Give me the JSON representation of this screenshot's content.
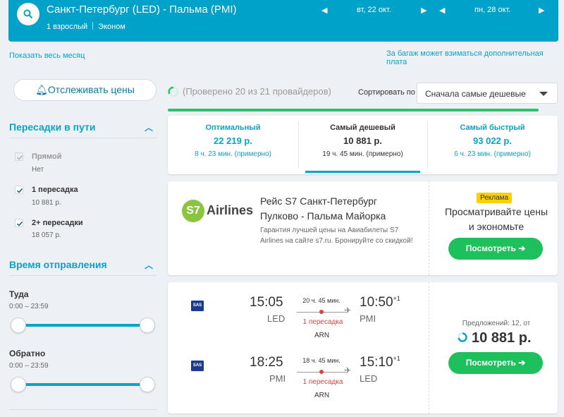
{
  "header": {
    "route": "Санкт-Петербург (LED) - Пальма (PMI)",
    "passengers": "1 взрослый",
    "cabin": "Эконом",
    "depart_date": "вт, 22 окт.",
    "return_date": "пн, 28 окт."
  },
  "links": {
    "show_month": "Показать весь месяц",
    "baggage_note": "За багаж может взиматься дополнительная плата"
  },
  "sidebar": {
    "track_label": "Отслеживать цены",
    "stops_title": "Пересадки в пути",
    "stops": [
      {
        "label": "Прямой",
        "sub": "Нет",
        "checked": true,
        "disabled": true
      },
      {
        "label": "1 пересадка",
        "sub": "10 881 р.",
        "checked": true,
        "disabled": false
      },
      {
        "label": "2+ пересадки",
        "sub": "18 057 р.",
        "checked": true,
        "disabled": false
      }
    ],
    "time_title": "Время отправления",
    "outbound_label": "Туда",
    "outbound_range": "0:00 – 23:59",
    "return_label": "Обратно",
    "return_range": "0:00 – 23:59"
  },
  "results": {
    "checked_text": "(Проверено 20 из 21 провайдеров)",
    "progress": 0.95,
    "sort_label": "Сортировать по",
    "sort_value": "Сначала самые дешевые",
    "tabs": [
      {
        "title": "Оптимальный",
        "price": "22 219 р.",
        "duration": "8 ч. 23 мин. (примерно)"
      },
      {
        "title": "Самый дешевый",
        "price": "10 881 р.",
        "duration": "19 ч. 45 мин. (примерно)"
      },
      {
        "title": "Самый быстрый",
        "price": "93 022 р.",
        "duration": "6 ч. 23 мин. (примерно)"
      }
    ],
    "ad": {
      "logo_text": "Airlines",
      "title": "Рейс S7 Санкт-Петербург Пулково - Пальма Майорка",
      "desc": "Гарантия лучшей цены на Авиабилеты S7 Airlines на сайте s7.ru. Бронируйте со скидкой!",
      "badge": "Реклама",
      "promo": "Просматривайте цены и экономьте",
      "button": "Посмотреть"
    },
    "flight": {
      "airline_logo": "SAS",
      "out": {
        "dep_time": "15:05",
        "dep_code": "LED",
        "duration": "20 ч. 45 мин.",
        "stops": "1 пересадка",
        "via": "ARN",
        "arr_time": "10:50",
        "arr_plus": "+1",
        "arr_code": "PMI"
      },
      "ret": {
        "dep_time": "18:25",
        "dep_code": "PMI",
        "duration": "18 ч. 45 мин.",
        "stops": "1 пересадка",
        "via": "ARN",
        "arr_time": "15:10",
        "arr_plus": "+1",
        "arr_code": "LED"
      },
      "offers": "Предложений: 12, от",
      "price": "10 881 р.",
      "button": "Посмотреть"
    }
  },
  "colors": {
    "header": "#00a2ca",
    "accent": "#0aa3c7",
    "green": "#1ec05c",
    "red": "#e04040",
    "badge": "#ffd000"
  }
}
